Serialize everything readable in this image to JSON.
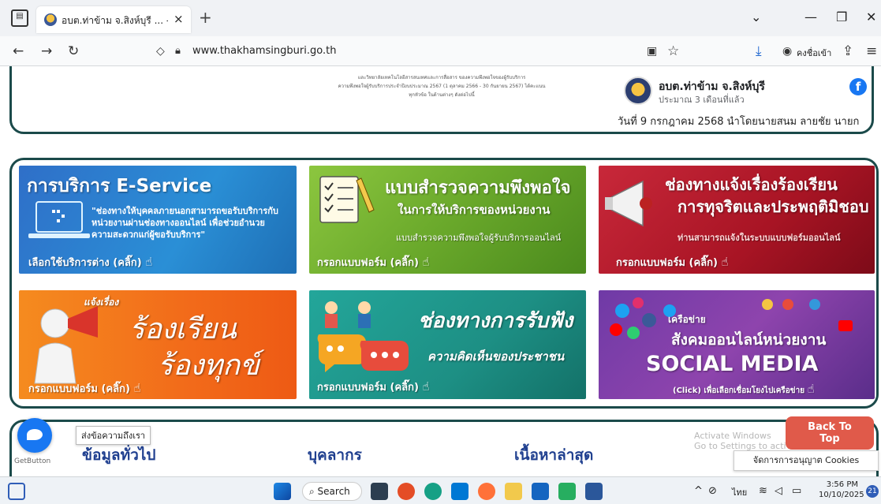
{
  "browser": {
    "tab_title": "อบต.ท่าข้าม จ.สิงห์บุรี ... - ยินดีต้อ",
    "url": "www.thakhamsingburi.go.th",
    "profile_label": "คงชื่อเข้า"
  },
  "top": {
    "survey_text_line1": "และวิทยาลัยเทคโนโลยีสารสนเทศและการสื่อสาร ของความพึงพอใจของผู้รับบริการ",
    "survey_text_line2": "ความพึงพอใจผู้รับบริการประจำปีงบประมาณ 2567 (1 ตุลาคม 2566 - 30 กันยายน 2567) ได้คะแนน",
    "survey_text_line3": "ทุกหัวข้อ ในด้านต่างๆ ดังต่อไปนี้",
    "fb_name": "อบต.ท่าข้าม จ.สิงห์บุรี",
    "fb_time": "ประมาณ 3 เดือนที่แล้ว",
    "fb_post": "วันที่ 9 กรกฎาคม 2568 นำโดยนายสนม ลายชัย นายก"
  },
  "banners": {
    "eservice": {
      "title": "การบริการ E-Service",
      "desc1": "\"ช่องทางให้บุคคลภายนอกสามารถขอรับบริการกับ",
      "desc2": "หน่วยงานผ่านช่องทางออนไลน์ เพื่อช่วยอำนวย",
      "desc3": "ความสะดวกแก่ผู้ขอรับบริการ\"",
      "cta": "เลือกใช้บริการต่าง (คลิ๊ก)"
    },
    "survey": {
      "title1": "แบบสำรวจความพึงพอใจ",
      "title2": "ในการให้บริการของหน่วยงาน",
      "desc": "แบบสำรวจความพึงพอใจผู้รับบริการออนไลน์",
      "cta": "กรอกแบบฟอร์ม (คลิ๊ก)"
    },
    "corruption": {
      "title1": "ช่องทางแจ้งเรื่องร้องเรียน",
      "title2": "การทุจริตและประพฤติมิชอบ",
      "desc": "ท่านสามารถแจ้งในระบบแบบฟอร์มออนไลน์",
      "cta": "กรอกแบบฟอร์ม (คลิ๊ก)"
    },
    "complaint": {
      "small": "แจ้งเรื่อง",
      "title1": "ร้องเรียน",
      "title2": "ร้องทุกข์",
      "cta": "กรอกแบบฟอร์ม (คลิ๊ก)"
    },
    "listen": {
      "title1": "ช่องทางการรับฟัง",
      "title2": "ความคิดเห็นของประชาชน",
      "cta": "กรอกแบบฟอร์ม (คลิ๊ก)"
    },
    "social": {
      "small": "เครือข่าย",
      "title1": "สังคมออนไลน์หน่วยงาน",
      "title2": "SOCIAL MEDIA",
      "cta": "(Click) เพื่อเลือกเชื่อมโยงไปเครือข่าย"
    }
  },
  "bottom": {
    "col1": "ข้อมูลทั่วไป",
    "col2": "บุคลากร",
    "col3": "เนื้อหาล่าสุด",
    "msg_tooltip": "ส่งข้อความถึงเรา",
    "getbutton": "GetButton",
    "back_to_top_1": "Back To",
    "back_to_top_2": "Top",
    "cookie_btn": "จัดการการอนุญาต Cookies",
    "activate_line1": "Activate Windows",
    "activate_line2": "Go to Settings to activate Windows."
  },
  "taskbar": {
    "search": "Search",
    "lang": "ไทย",
    "time": "3:56 PM",
    "date": "10/10/2025",
    "notif_count": "21"
  }
}
